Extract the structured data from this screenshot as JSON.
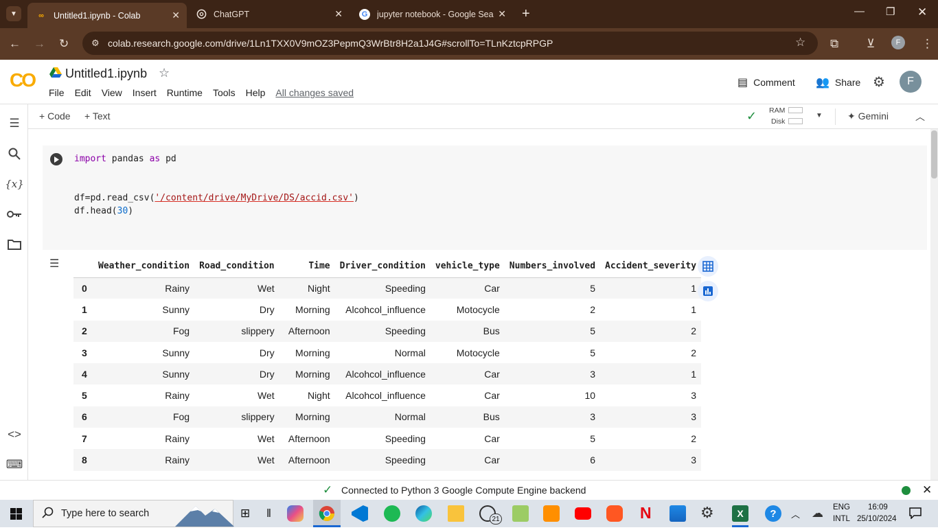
{
  "browser": {
    "tabs": [
      {
        "title": "Untitled1.ipynb - Colab",
        "active": true
      },
      {
        "title": "ChatGPT",
        "active": false
      },
      {
        "title": "jupyter notebook - Google Sear",
        "active": false
      }
    ],
    "url": "colab.research.google.com/drive/1Ln1TXX0V9mOZ3PepmQ3WrBtr8H2a1J4G#scrollTo=TLnKztcpRPGP",
    "profile_initial": "F"
  },
  "colab": {
    "logo": "CO",
    "notebook_title": "Untitled1.ipynb",
    "menu": [
      "File",
      "Edit",
      "View",
      "Insert",
      "Runtime",
      "Tools",
      "Help"
    ],
    "save_status": "All changes saved",
    "comment_label": "Comment",
    "share_label": "Share",
    "user_initial": "F",
    "add_code_label": "Code",
    "add_text_label": "Text",
    "ram_label": "RAM",
    "disk_label": "Disk",
    "gemini_label": "Gemini"
  },
  "cell": {
    "line1_kw1": "import",
    "line1_mid": " pandas ",
    "line1_kw2": "as",
    "line1_end": " pd",
    "line2_pre": "df=pd.read_csv(",
    "line2_str": "'/content/drive/MyDrive/DS/accid.csv'",
    "line2_post": ")",
    "line3_pre": "df.head(",
    "line3_num": "30",
    "line3_post": ")"
  },
  "table": {
    "columns": [
      "",
      "Weather_condition",
      "Road_condition",
      "Time",
      "Driver_condition",
      "vehicle_type",
      "Numbers_involved",
      "Accident_severity"
    ],
    "rows": [
      [
        "0",
        "Rainy",
        "Wet",
        "Night",
        "Speeding",
        "Car",
        "5",
        "1"
      ],
      [
        "1",
        "Sunny",
        "Dry",
        "Morning",
        "Alcohcol_influence",
        "Motocycle",
        "2",
        "1"
      ],
      [
        "2",
        "Fog",
        "slippery",
        "Afternoon",
        "Speeding",
        "Bus",
        "5",
        "2"
      ],
      [
        "3",
        "Sunny",
        "Dry",
        "Morning",
        "Normal",
        "Motocycle",
        "5",
        "2"
      ],
      [
        "4",
        "Sunny",
        "Dry",
        "Morning",
        "Alcohcol_influence",
        "Car",
        "3",
        "1"
      ],
      [
        "5",
        "Rainy",
        "Wet",
        "Night",
        "Alcohcol_influence",
        "Car",
        "10",
        "3"
      ],
      [
        "6",
        "Fog",
        "slippery",
        "Morning",
        "Normal",
        "Bus",
        "3",
        "3"
      ],
      [
        "7",
        "Rainy",
        "Wet",
        "Afternoon",
        "Speeding",
        "Car",
        "5",
        "2"
      ],
      [
        "8",
        "Rainy",
        "Wet",
        "Afternoon",
        "Speeding",
        "Car",
        "6",
        "3"
      ]
    ]
  },
  "status": {
    "text": "Connected to Python 3 Google Compute Engine backend"
  },
  "taskbar": {
    "search_placeholder": "Type here to search",
    "lang_top": "ENG",
    "lang_bottom": "INTL",
    "time": "16:09",
    "date": "25/10/2024",
    "whatsapp_badge": "21"
  },
  "colors": {
    "chrome_dark": "#3c2416",
    "chrome_mid": "#5a3a26",
    "colab_orange": "#f9ab00",
    "accent_blue": "#1967d2",
    "status_green": "#1e8e3e"
  }
}
